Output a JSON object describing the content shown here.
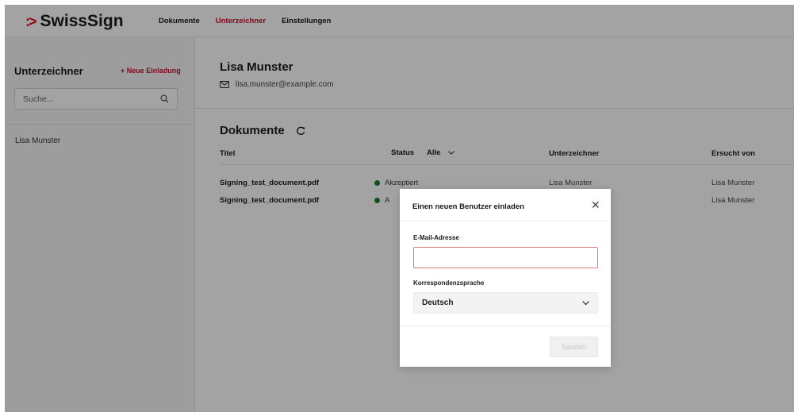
{
  "brand": {
    "name": "SwissSign",
    "mark": ":>"
  },
  "nav": {
    "items": [
      {
        "label": "Dokumente",
        "active": false
      },
      {
        "label": "Unterzeichner",
        "active": true
      },
      {
        "label": "Einstellungen",
        "active": false
      }
    ]
  },
  "sidebar": {
    "title": "Unterzeichner",
    "new_invite": "+ Neue Einladung",
    "search_placeholder": "Suche...",
    "items": [
      {
        "label": "Lisa Munster"
      }
    ]
  },
  "user": {
    "name": "Lisa Munster",
    "email": "lisa.munster@example.com"
  },
  "documents": {
    "title": "Dokumente",
    "columns": {
      "title": "Titel",
      "status": "Status",
      "status_filter": "Alle",
      "signer": "Unterzeichner",
      "requested_by": "Ersucht von"
    },
    "rows": [
      {
        "title": "Signing_test_document.pdf",
        "status": "Akzeptiert",
        "signer": "Lisa Munster",
        "requested_by": "Lisa Munster"
      },
      {
        "title": "Signing_test_document.pdf",
        "status": "A",
        "signer": "",
        "requested_by": "Lisa Munster"
      }
    ]
  },
  "modal": {
    "title": "Einen neuen Benutzer einladen",
    "email_label": "E-Mail-Adresse",
    "email_value": "",
    "language_label": "Korrespondenzsprache",
    "language_value": "Deutsch",
    "send_label": "Senden"
  },
  "colors": {
    "accent": "#c8102e",
    "status_ok": "#1f7a34",
    "overlay": "rgba(0,0,0,0.36)"
  }
}
